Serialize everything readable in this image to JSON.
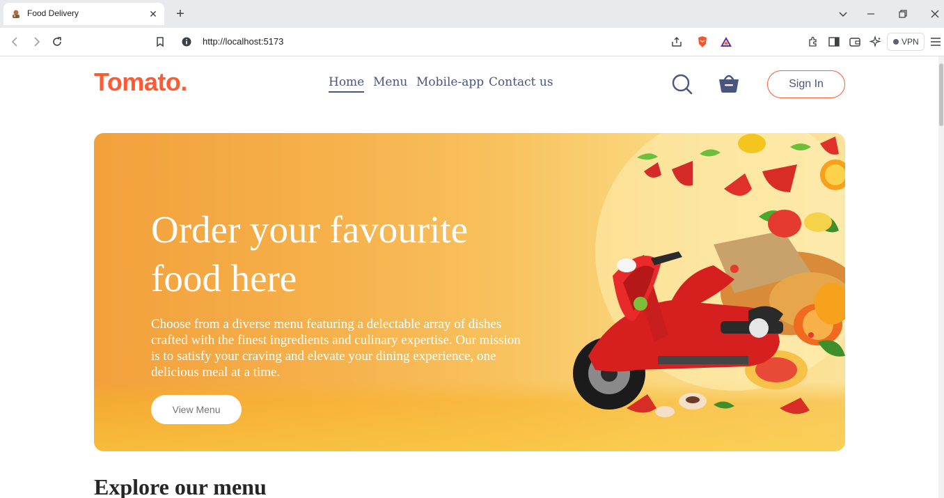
{
  "browser": {
    "tab_title": "Food Delivery",
    "url": "http://localhost:5173",
    "vpn_label": "VPN"
  },
  "site": {
    "logo": "Tomato.",
    "nav": [
      "Home",
      "Menu",
      "Mobile-app",
      "Contact us"
    ],
    "active_nav": "Home",
    "sign_in_label": "Sign In",
    "accent_color": "#ff5a32",
    "nav_color": "#49557e"
  },
  "hero": {
    "title": "Order your favourite food here",
    "description": "Choose from a diverse menu featuring a delectable array of dishes crafted with the finest ingredients and culinary expertise. Our mission is to satisfy your craving and elevate your dining experience, one delicious meal at a time.",
    "button_label": "View Menu"
  },
  "explore": {
    "heading": "Explore our menu"
  }
}
